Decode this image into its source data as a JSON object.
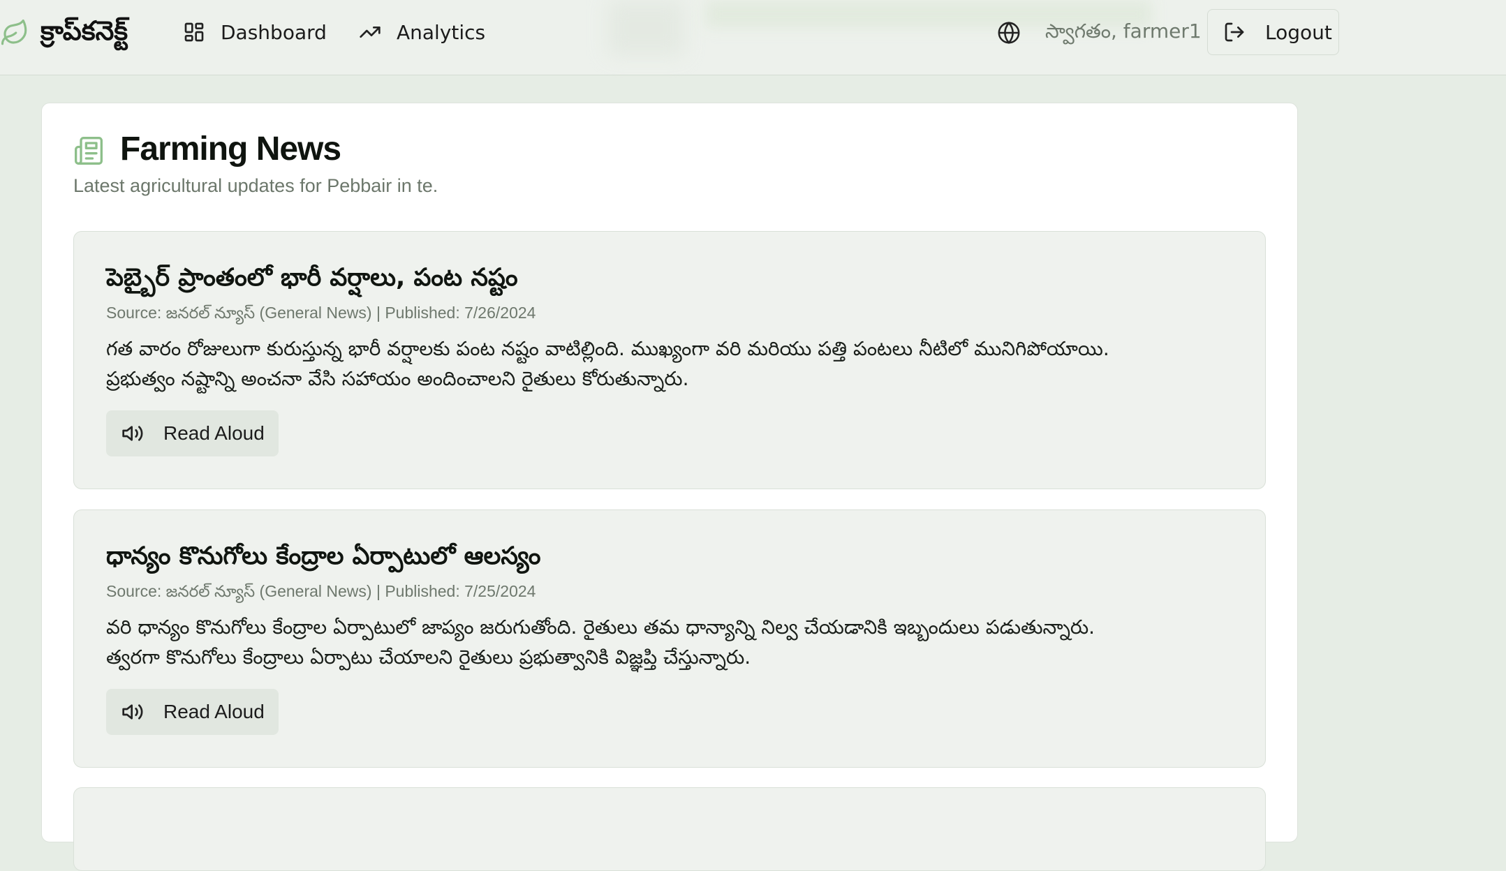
{
  "header": {
    "brand": "క్రాప్‌కనెక్ట్",
    "nav": [
      {
        "label": "Dashboard",
        "icon": "dashboard-grid-icon"
      },
      {
        "label": "Analytics",
        "icon": "trending-up-icon"
      }
    ],
    "language_icon": "globe-icon",
    "welcome": "స్వాగతం, farmer1",
    "logout_label": "Logout",
    "logout_icon": "logout-icon"
  },
  "page": {
    "title": "Farming News",
    "subtitle": "Latest agricultural updates for Pebbair in te.",
    "title_icon": "newspaper-icon"
  },
  "articles": [
    {
      "title": "పెబ్బైర్ ప్రాంతంలో భారీ వర్షాలు, పంట నష్టం",
      "meta": "Source: జనరల్ న్యూస్ (General News) | Published: 7/26/2024",
      "body_line1": "గత వారం రోజులుగా కురుస్తున్న భారీ వర్షాలకు పంట నష్టం వాటిల్లింది. ముఖ్యంగా వరి మరియు పత్తి పంటలు నీటిలో మునిగిపోయాయి.",
      "body_line2": "ప్రభుత్వం నష్టాన్ని అంచనా వేసి సహాయం అందించాలని రైతులు కోరుతున్నారు.",
      "button_label": "Read Aloud"
    },
    {
      "title": "ధాన్యం కొనుగోలు కేంద్రాల ఏర్పాటులో ఆలస్యం",
      "meta": "Source: జనరల్ న్యూస్ (General News) | Published: 7/25/2024",
      "body_line1": "వరి ధాన్యం కొనుగోలు కేంద్రాల ఏర్పాటులో జాప్యం జరుగుతోంది. రైతులు తమ ధాన్యాన్ని నిల్వ చేయడానికి ఇబ్బందులు పడుతున్నారు.",
      "body_line2": "త్వరగా కొనుగోలు కేంద్రాలు ఏర్పాటు చేయాలని రైతులు ప్రభుత్వానికి విజ్ఞప్తి చేస్తున్నారు.",
      "button_label": "Read Aloud"
    }
  ],
  "colors": {
    "background": "#e6ede5",
    "header": "#edf1ec",
    "card": "#ffffff",
    "article": "#eff2ee",
    "accent_green": "#8dbf8a",
    "muted_text": "#6f7a6e"
  }
}
